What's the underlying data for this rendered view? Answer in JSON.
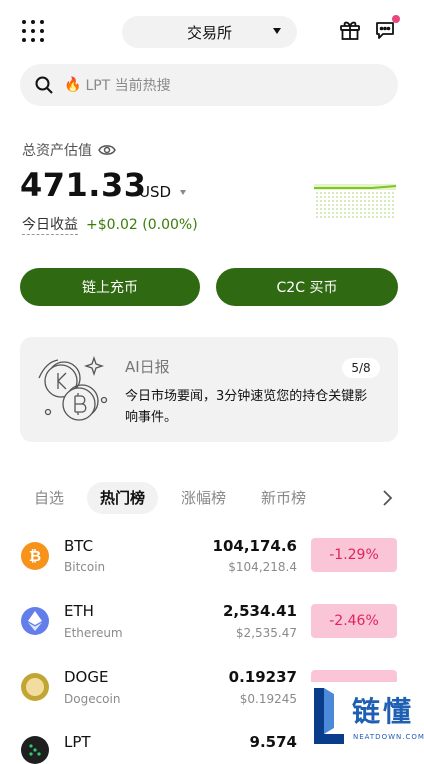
{
  "top_bar": {
    "exchange_label": "交易所"
  },
  "search": {
    "icon": "fire-icon",
    "placeholder": "LPT 当前热搜"
  },
  "assets": {
    "label": "总资产估值",
    "balance": "471.33",
    "currency": "USD",
    "pnl_label": "今日收益",
    "pnl_value": "+$0.02 (0.00%)"
  },
  "actions": {
    "deposit": "链上充币",
    "c2c": "C2C 买币"
  },
  "ai_report": {
    "title": "AI日报",
    "page": "5/8",
    "text": "今日市场要闻，3分钟速览您的持仓关键影响事件。"
  },
  "tabs": [
    "自选",
    "热门榜",
    "涨幅榜",
    "新币榜"
  ],
  "active_tab": "热门榜",
  "markets": [
    {
      "symbol": "BTC",
      "name": "Bitcoin",
      "price": "104,174.6",
      "price_usd": "$104,218.4",
      "change": "-1.29%",
      "icon": "bitcoin-icon",
      "color": "#f7931a"
    },
    {
      "symbol": "ETH",
      "name": "Ethereum",
      "price": "2,534.41",
      "price_usd": "$2,535.47",
      "change": "-2.46%",
      "icon": "ethereum-icon",
      "color": "#627eea"
    },
    {
      "symbol": "DOGE",
      "name": "Dogecoin",
      "price": "0.19237",
      "price_usd": "$0.19245",
      "change": "",
      "icon": "dogecoin-icon",
      "color": "#c2a633"
    },
    {
      "symbol": "LPT",
      "name": "",
      "price": "9.574",
      "price_usd": "",
      "change": "",
      "icon": "livepeer-icon",
      "color": "#1f1f1f"
    }
  ],
  "colors": {
    "accent": "#2f6a12",
    "negative": "#e0245e",
    "negative_bg": "#fac5d7",
    "positive": "#3a7d0a"
  },
  "watermark": {
    "text": "链懂",
    "sub": "NEATDOWN.COM"
  }
}
